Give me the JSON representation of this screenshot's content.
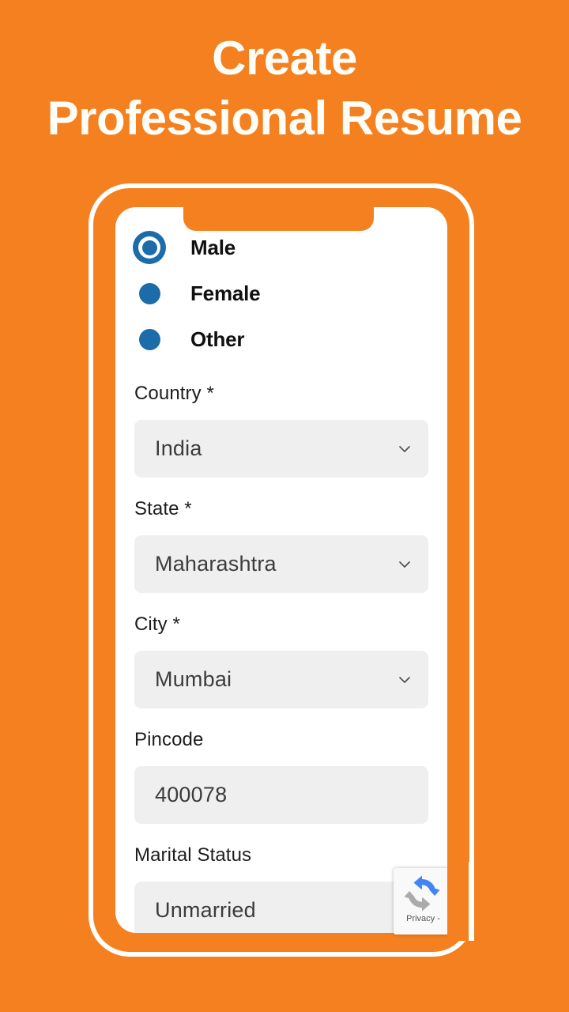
{
  "theme": {
    "background": "#F4801F",
    "accent_blue": "#1B6CA8",
    "field_bg": "#EFEFEF",
    "headline_color": "#FFFDF7"
  },
  "headline": {
    "line1": "Create",
    "line2": "Professional Resume"
  },
  "phone": {
    "screen": {
      "gender": {
        "options": [
          {
            "label": "Male",
            "selected": true
          },
          {
            "label": "Female",
            "selected": false
          },
          {
            "label": "Other",
            "selected": false
          }
        ]
      },
      "fields": [
        {
          "label": "Country *",
          "value": "India",
          "type": "select",
          "icon": "chevron-down-icon"
        },
        {
          "label": "State *",
          "value": "Maharashtra",
          "type": "select",
          "icon": "chevron-down-icon"
        },
        {
          "label": "City *",
          "value": "Mumbai",
          "type": "select",
          "icon": "chevron-down-icon"
        },
        {
          "label": "Pincode",
          "value": "400078",
          "type": "text",
          "icon": ""
        },
        {
          "label": "Marital Status",
          "value": "Unmarried",
          "type": "select",
          "icon": ""
        }
      ]
    }
  },
  "recaptcha": {
    "privacy_label": "Privacy - ",
    "logo_icon": "recaptcha-icon"
  }
}
